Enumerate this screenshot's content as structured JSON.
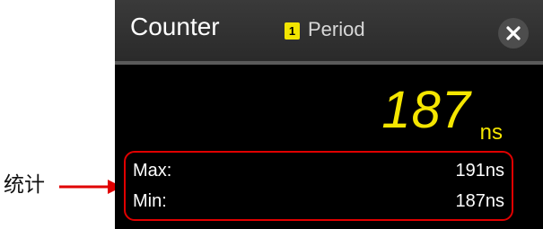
{
  "annotation": {
    "label": "统计",
    "color": "#e00000"
  },
  "counter": {
    "title": "Counter",
    "channel_number": "1",
    "channel_color": "#f2e500",
    "measurement_type": "Period",
    "close_icon": "close-icon",
    "value": "187",
    "unit": "ns",
    "value_color": "#f5e600",
    "statistics": {
      "max_label": "Max:",
      "max_value": "191ns",
      "min_label": "Min:",
      "min_value": "187ns"
    }
  }
}
